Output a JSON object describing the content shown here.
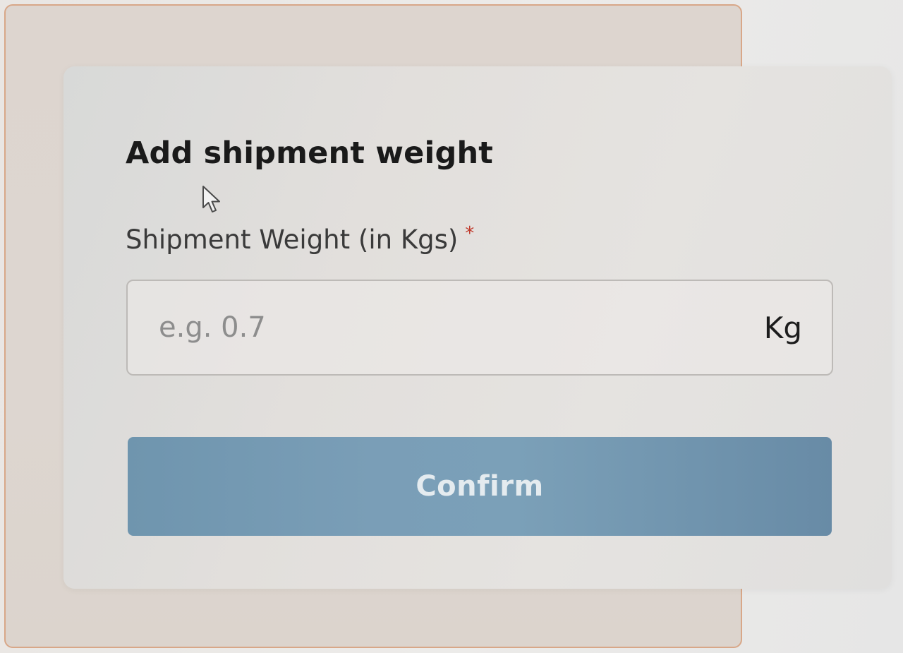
{
  "modal": {
    "title": "Add shipment weight",
    "field": {
      "label": "Shipment Weight (in Kgs)",
      "required_mark": "*",
      "placeholder": "e.g. 0.7",
      "value": "",
      "unit": "Kg"
    },
    "confirm_label": "Confirm"
  },
  "icons": {
    "cursor": "mouse-pointer-icon"
  },
  "colors": {
    "button_bg": "#7a9eb7",
    "button_text": "#e4ebef",
    "required": "#c0392b",
    "card_border": "#d8a788"
  }
}
